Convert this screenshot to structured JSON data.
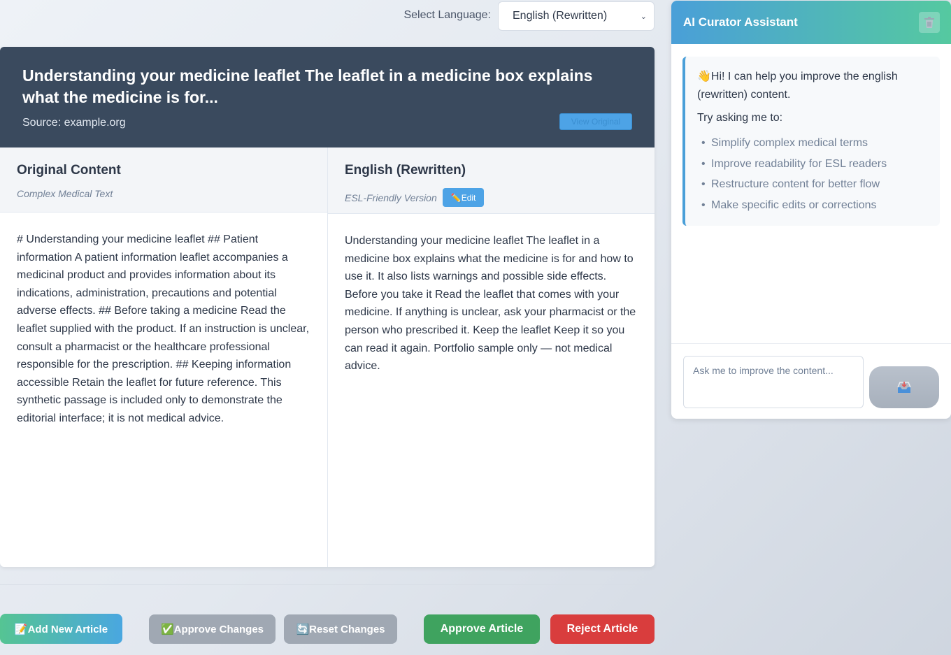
{
  "language": {
    "label": "Select Language:",
    "selected": "English (Rewritten)"
  },
  "article": {
    "title": "Understanding your medicine leaflet The leaflet in a medicine box explains what the medicine is for...",
    "source": "Source: example.org",
    "view_original_label": "View Original"
  },
  "original": {
    "title": "Original Content",
    "subtitle": "Complex Medical Text",
    "text": "# Understanding your medicine leaflet ## Patient information A patient information leaflet accompanies a medicinal product and provides information about its indications, administration, precautions and potential adverse effects. ## Before taking a medicine Read the leaflet supplied with the product. If an instruction is unclear, consult a pharmacist or the healthcare professional responsible for the prescription. ## Keeping information accessible Retain the leaflet for future reference. This synthetic passage is included only to demonstrate the editorial interface; it is not medical advice."
  },
  "rewritten": {
    "title": "English (Rewritten)",
    "subtitle": "ESL-Friendly Version",
    "edit_label": "✏️Edit",
    "text": "Understanding your medicine leaflet The leaflet in a medicine box explains what the medicine is for and how to use it. It also lists warnings and possible side effects. Before you take it Read the leaflet that comes with your medicine. If anything is unclear, ask your pharmacist or the person who prescribed it. Keep the leaflet Keep it so you can read it again. Portfolio sample only — not medical advice."
  },
  "actions": {
    "add_article": "📝Add New Article",
    "approve_changes": "✅Approve Changes",
    "reset_changes": "🔄Reset Changes",
    "approve_article": "Approve Article",
    "reject_article": "Reject Article"
  },
  "assistant": {
    "title": "AI Curator Assistant",
    "greeting": "👋Hi! I can help you improve the english (rewritten) content.",
    "prompt": "Try asking me to:",
    "suggestions": [
      "Simplify complex medical terms",
      "Improve readability for ESL readers",
      "Restructure content for better flow",
      "Make specific edits or corrections"
    ],
    "input_placeholder": "Ask me to improve the content...",
    "send_icon": "inbox-tray-icon",
    "clear_icon": "trash-icon"
  },
  "colors": {
    "header_bg": "#3a4a5e",
    "accent_blue": "#4da3e6",
    "approve_green": "#3fa35f",
    "reject_red": "#d93d3d",
    "disabled_gray": "#a0a8b3"
  }
}
